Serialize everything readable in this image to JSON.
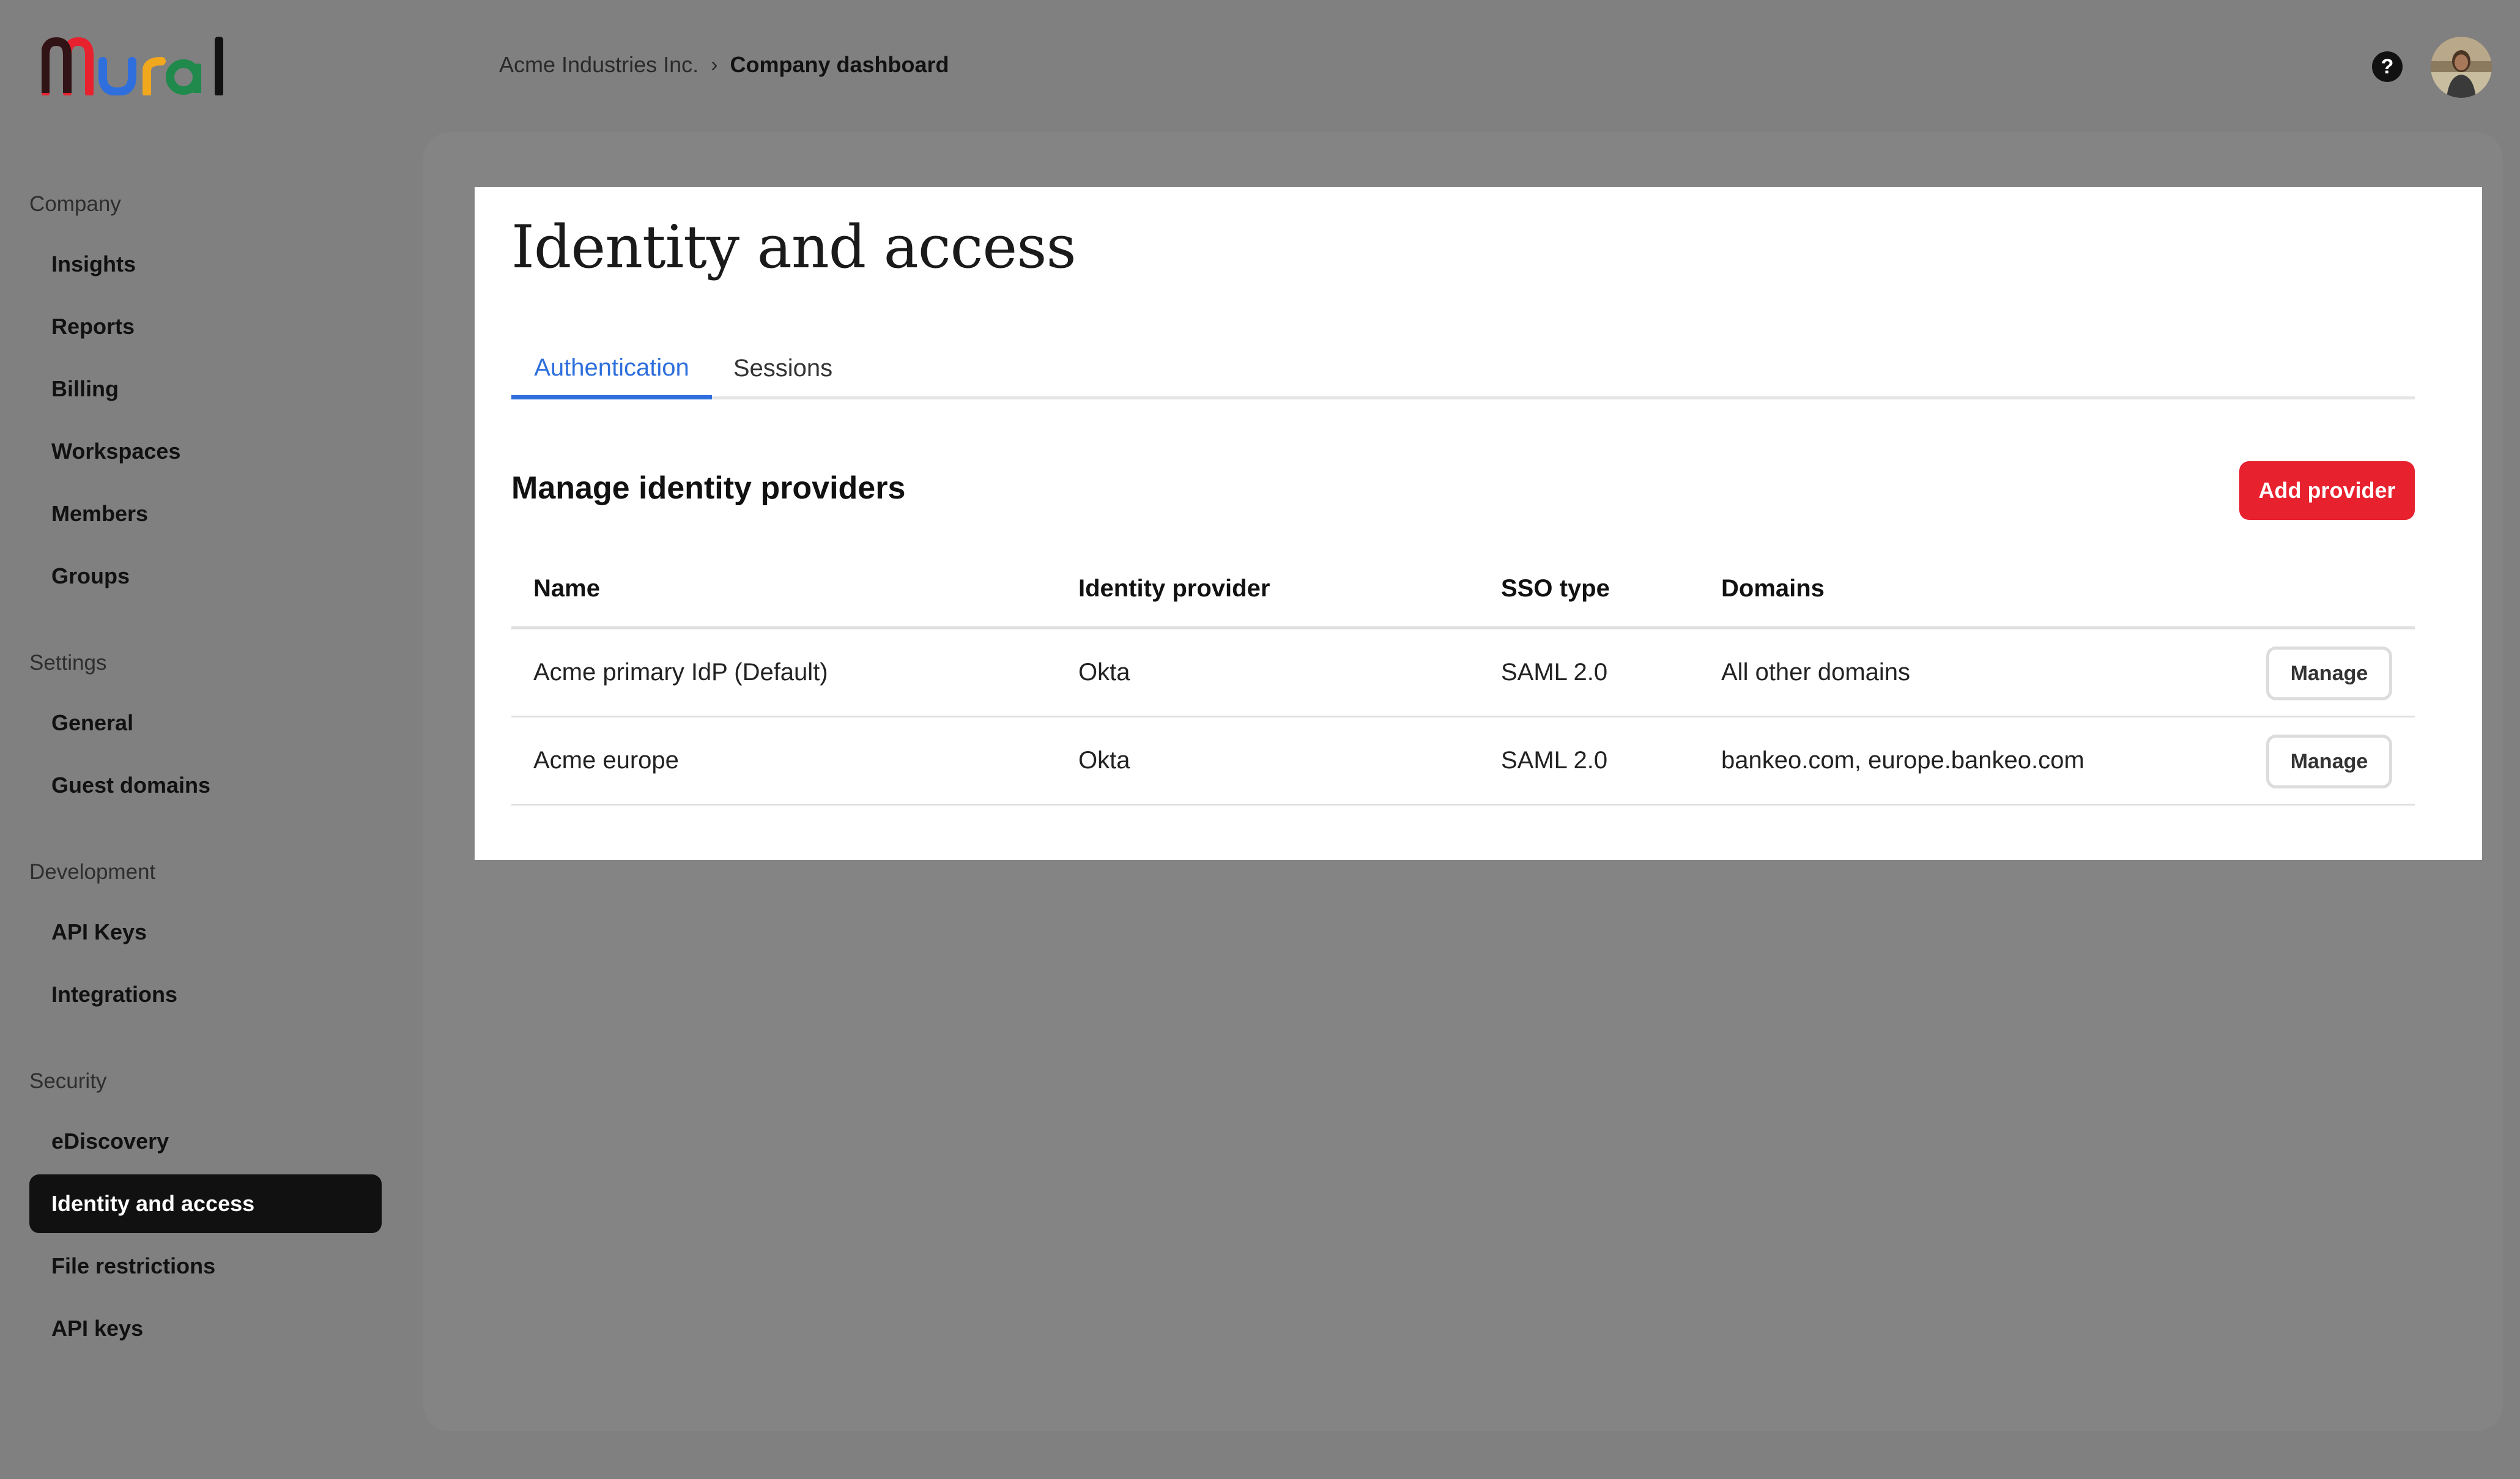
{
  "app": {
    "logo_text": "Mural",
    "colors": {
      "accent_blue": "#2f6fdd",
      "primary_red": "#e8212f",
      "active_nav_bg": "#111111",
      "overlay_gray": "#808080"
    }
  },
  "header": {
    "breadcrumb": {
      "parent": "Acme Industries Inc.",
      "separator": "›",
      "current": "Company dashboard"
    },
    "help_icon": "?",
    "icons": {
      "help": "question-circle-icon",
      "separator": "chevron-right-icon"
    }
  },
  "sidebar": {
    "sections": [
      {
        "title": "Company",
        "items": [
          "Insights",
          "Reports",
          "Billing",
          "Workspaces",
          "Members",
          "Groups"
        ]
      },
      {
        "title": "Settings",
        "items": [
          "General",
          "Guest domains"
        ]
      },
      {
        "title": "Development",
        "items": [
          "API Keys",
          "Integrations"
        ]
      },
      {
        "title": "Security",
        "items": [
          "eDiscovery",
          "Identity and access",
          "File restrictions",
          "API keys"
        ]
      }
    ],
    "active_item": "Identity and access"
  },
  "main": {
    "title": "Identity and access",
    "tabs": [
      {
        "label": "Authentication",
        "active": true
      },
      {
        "label": "Sessions",
        "active": false
      }
    ],
    "section": {
      "heading": "Manage identity providers",
      "add_button_label": "Add provider"
    },
    "table": {
      "columns": [
        "Name",
        "Identity provider",
        "SSO type",
        "Domains"
      ],
      "rows": [
        {
          "name": "Acme primary IdP (Default)",
          "identity_provider": "Okta",
          "sso_type": "SAML 2.0",
          "domains": "All other domains",
          "action_label": "Manage"
        },
        {
          "name": "Acme europe",
          "identity_provider": "Okta",
          "sso_type": "SAML 2.0",
          "domains": "bankeo.com, europe.bankeo.com",
          "action_label": "Manage"
        }
      ]
    }
  }
}
